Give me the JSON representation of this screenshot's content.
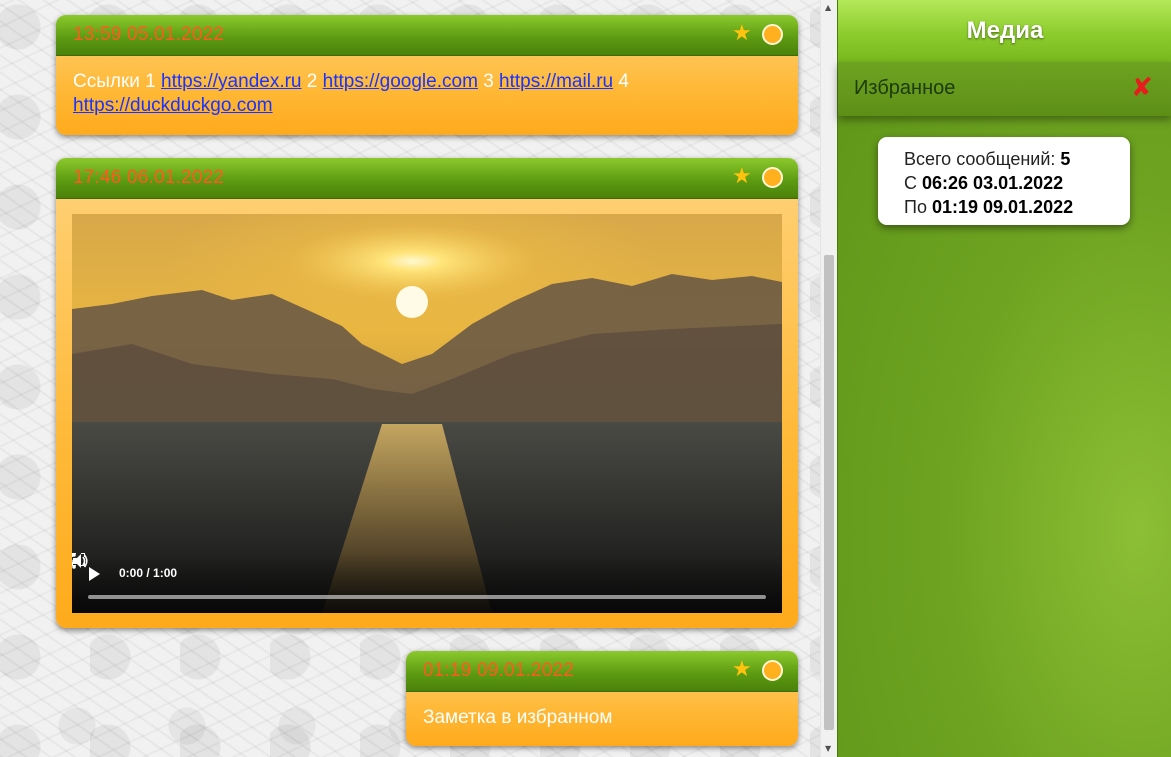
{
  "feed": {
    "messages": [
      {
        "time": "13:59 05.01.2022",
        "links_text": {
          "prefix": "Ссылки 1",
          "link1": "https://yandex.ru",
          "n2": "2",
          "link2": "https://google.com",
          "n3": "3",
          "link3": "https://mail.ru",
          "n4": "4",
          "link4": "https://duckduckgo.com"
        }
      },
      {
        "time": "17:46 06.01.2022",
        "video": {
          "time_display": "0:00 / 1:00",
          "progress": 0
        }
      },
      {
        "time": "01:19 09.01.2022",
        "text": "Заметка в избранном"
      }
    ],
    "icons": {
      "favorite": "star-icon",
      "select": "circle-icon"
    }
  },
  "panel": {
    "title": "Медиа",
    "favorites_label": "Избранное",
    "close_icon": "close-icon",
    "stats": {
      "total_label": "Всего сообщений:",
      "total_value": "5",
      "from_label": "С",
      "from_value": "06:26 03.01.2022",
      "to_label": "По",
      "to_value": "01:19 09.01.2022"
    }
  },
  "colors": {
    "header_green": "#5e9c12",
    "card_orange": "#ffb938",
    "time_text": "#ff5a1f",
    "link": "#1a33ff",
    "star": "#ffc20e",
    "close": "#e81c1c"
  }
}
